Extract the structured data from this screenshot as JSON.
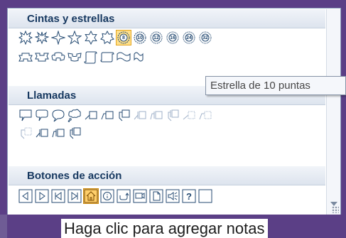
{
  "sections": [
    {
      "title": "Cintas y estrellas"
    },
    {
      "title": "Llamadas"
    },
    {
      "title": "Botones de acción"
    }
  ],
  "tooltip": "Estrella de 10 puntas",
  "star_labels": [
    "8",
    "10",
    "12",
    "16",
    "24",
    "32"
  ],
  "action_button_labels": [
    "?"
  ],
  "slide_placeholder": "Haga clic para agregar notas",
  "colors": {
    "accent_selected": "#ffe08a",
    "section_text": "#15375f",
    "shape_stroke": "#244a72",
    "window_bg": "#5b3f86"
  }
}
